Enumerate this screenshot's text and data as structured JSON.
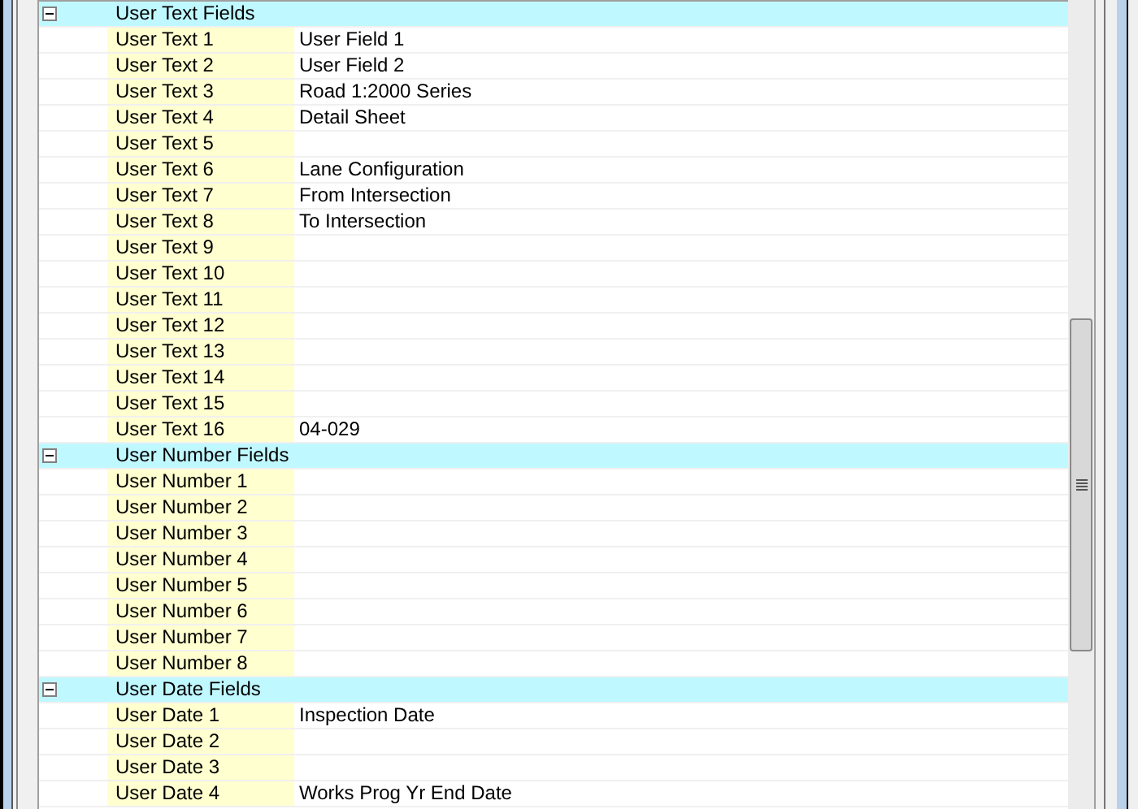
{
  "sections": [
    {
      "title": "User Text Fields",
      "expanded": true,
      "rows": [
        {
          "label": "User Text 1",
          "value": "User Field 1"
        },
        {
          "label": "User Text 2",
          "value": "User Field 2"
        },
        {
          "label": "User Text 3",
          "value": "Road 1:2000 Series"
        },
        {
          "label": "User Text 4",
          "value": "Detail Sheet"
        },
        {
          "label": "User Text 5"
        },
        {
          "label": "User Text 6",
          "value": "Lane Configuration"
        },
        {
          "label": "User Text 7",
          "value": "From Intersection"
        },
        {
          "label": "User Text 8",
          "value": "To Intersection"
        },
        {
          "label": "User Text 9"
        },
        {
          "label": "User Text 10"
        },
        {
          "label": "User Text 11"
        },
        {
          "label": "User Text 12"
        },
        {
          "label": "User Text 13"
        },
        {
          "label": "User Text 14"
        },
        {
          "label": "User Text 15"
        },
        {
          "label": "User Text 16",
          "value": "04-029"
        }
      ]
    },
    {
      "title": "User Number Fields",
      "expanded": true,
      "rows": [
        {
          "label": "User Number 1"
        },
        {
          "label": "User Number 2"
        },
        {
          "label": "User Number 3"
        },
        {
          "label": "User Number 4"
        },
        {
          "label": "User Number 5"
        },
        {
          "label": "User Number 6"
        },
        {
          "label": "User Number 7"
        },
        {
          "label": "User Number 8"
        }
      ]
    },
    {
      "title": "User Date Fields",
      "expanded": true,
      "rows": [
        {
          "label": "User Date 1",
          "value": "Inspection Date"
        },
        {
          "label": "User Date 2"
        },
        {
          "label": "User Date 3"
        },
        {
          "label": "User Date 4",
          "value": "Works Prog Yr End Date"
        }
      ]
    }
  ]
}
